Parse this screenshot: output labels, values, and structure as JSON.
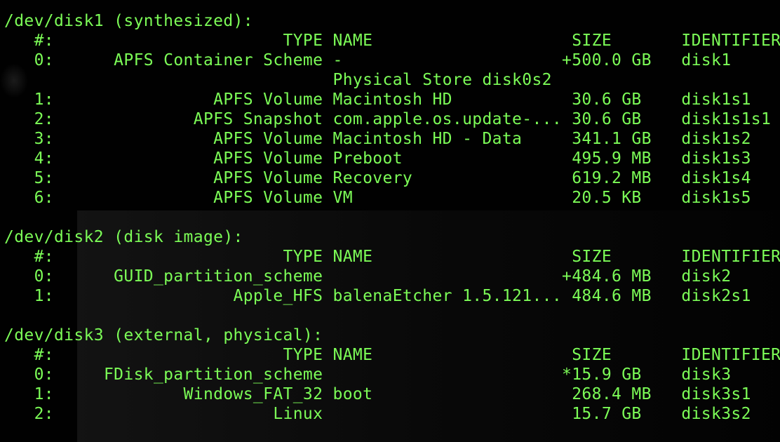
{
  "terminal": {
    "text_color": "#7CFC57",
    "background_color": "#010101",
    "lines": [
      "/dev/disk1 (synthesized):",
      "   #:                       TYPE NAME                    SIZE       IDENTIFIER",
      "   0:      APFS Container Scheme -                      +500.0 GB   disk1",
      "                                 Physical Store disk0s2",
      "   1:                APFS Volume Macintosh HD            30.6 GB    disk1s1",
      "   2:              APFS Snapshot com.apple.os.update-... 30.6 GB    disk1s1s1",
      "   3:                APFS Volume Macintosh HD - Data     341.1 GB   disk1s2",
      "   4:                APFS Volume Preboot                 495.9 MB   disk1s3",
      "   5:                APFS Volume Recovery                619.2 MB   disk1s4",
      "   6:                APFS Volume VM                      20.5 KB    disk1s5",
      "",
      "/dev/disk2 (disk image):",
      "   #:                       TYPE NAME                    SIZE       IDENTIFIER",
      "   0:      GUID_partition_scheme                        +484.6 MB   disk2",
      "   1:                  Apple_HFS balenaEtcher 1.5.121... 484.6 MB   disk2s1",
      "",
      "/dev/disk3 (external, physical):",
      "   #:                       TYPE NAME                    SIZE       IDENTIFIER",
      "   0:     FDisk_partition_scheme                        *15.9 GB    disk3",
      "   1:             Windows_FAT_32 boot                    268.4 MB   disk3s1",
      "   2:                      Linux                         15.7 GB    disk3s2"
    ]
  }
}
